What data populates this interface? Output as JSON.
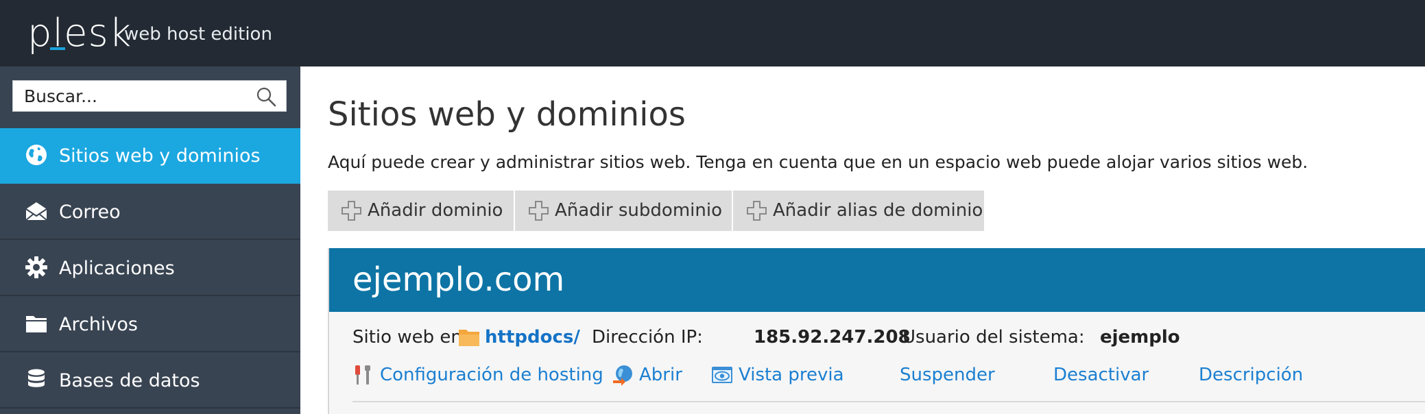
{
  "header": {
    "logo_text": "plesk",
    "edition": "web host edition"
  },
  "sidebar": {
    "search": {
      "placeholder": "Buscar..."
    },
    "items": [
      {
        "label": "Sitios web y dominios",
        "icon": "globe-icon",
        "active": true
      },
      {
        "label": "Correo",
        "icon": "mail-icon",
        "active": false
      },
      {
        "label": "Aplicaciones",
        "icon": "gear-icon",
        "active": false
      },
      {
        "label": "Archivos",
        "icon": "folder-icon",
        "active": false
      },
      {
        "label": "Bases de datos",
        "icon": "database-icon",
        "active": false
      }
    ]
  },
  "main": {
    "title": "Sitios web y dominios",
    "description": "Aquí puede crear y administrar sitios web. Tenga en cuenta que en un espacio web puede alojar varios sitios web.",
    "toolbar": [
      {
        "label": "Añadir dominio",
        "icon": "plus-icon"
      },
      {
        "label": "Añadir subdominio",
        "icon": "plus-icon"
      },
      {
        "label": "Añadir alias de dominio",
        "icon": "plus-icon"
      }
    ],
    "domain": {
      "name": "ejemplo.com",
      "site_prefix": "Sitio web en",
      "docroot": "httpdocs/",
      "ip_label": "Dirección IP:",
      "ip": "185.92.247.208",
      "user_label": "Usuario del sistema:",
      "user": "ejemplo",
      "actions": [
        {
          "label": "Configuración de hosting",
          "icon": "tools-icon"
        },
        {
          "label": "Abrir",
          "icon": "open-globe-icon"
        },
        {
          "label": "Vista previa",
          "icon": "eye-icon"
        },
        {
          "label": "Suspender"
        },
        {
          "label": "Desactivar"
        },
        {
          "label": "Descripción"
        }
      ]
    }
  },
  "colors": {
    "topbar": "#232a33",
    "sidebar": "#394452",
    "active_nav": "#1ba7e0",
    "domain_header": "#0d74a5",
    "link": "#1b7fd1"
  }
}
